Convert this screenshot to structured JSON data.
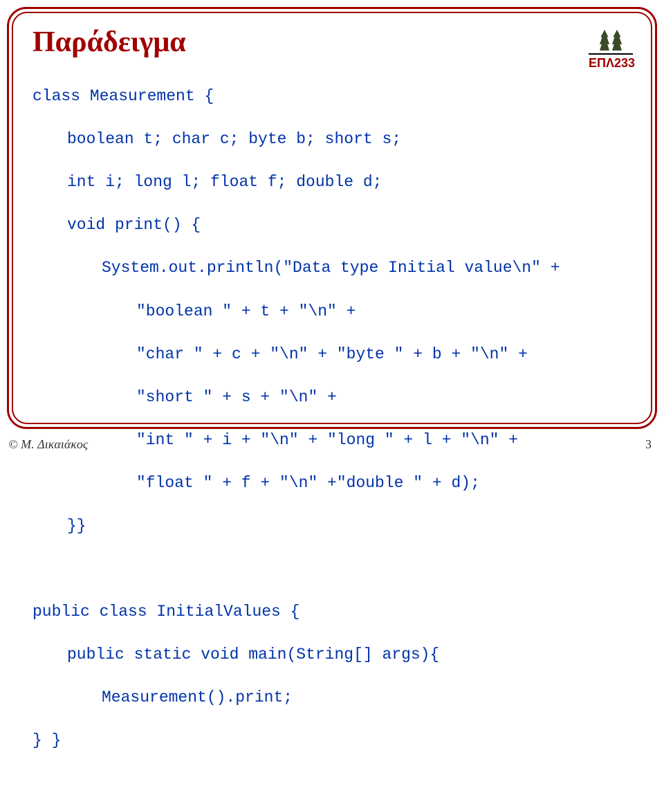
{
  "title": "Παράδειγμα",
  "logo_label": "ΕΠΛ233",
  "code": {
    "l01": "class Measurement {",
    "l02": "boolean t; char c; byte b; short s;",
    "l03": "int i; long l; float f; double d;",
    "l04": "void print() {",
    "l05": "System.out.println(\"Data type Initial value\\n\" +",
    "l06": "\"boolean \" + t + \"\\n\" +",
    "l07": "\"char \" + c + \"\\n\" + \"byte \" + b + \"\\n\" +",
    "l08": "\"short \" + s + \"\\n\" +",
    "l09": "\"int \" + i + \"\\n\" + \"long \" + l + \"\\n\" +",
    "l10": "\"float \" + f + \"\\n\" +\"double \" + d);",
    "l11": "}}",
    "l12": "public class InitialValues {",
    "l13": "public static void main(String[] args){",
    "l14": "Measurement().print;",
    "l15": "} }"
  },
  "footer": {
    "author": "© M. Δικαιάκος",
    "page": "3"
  }
}
